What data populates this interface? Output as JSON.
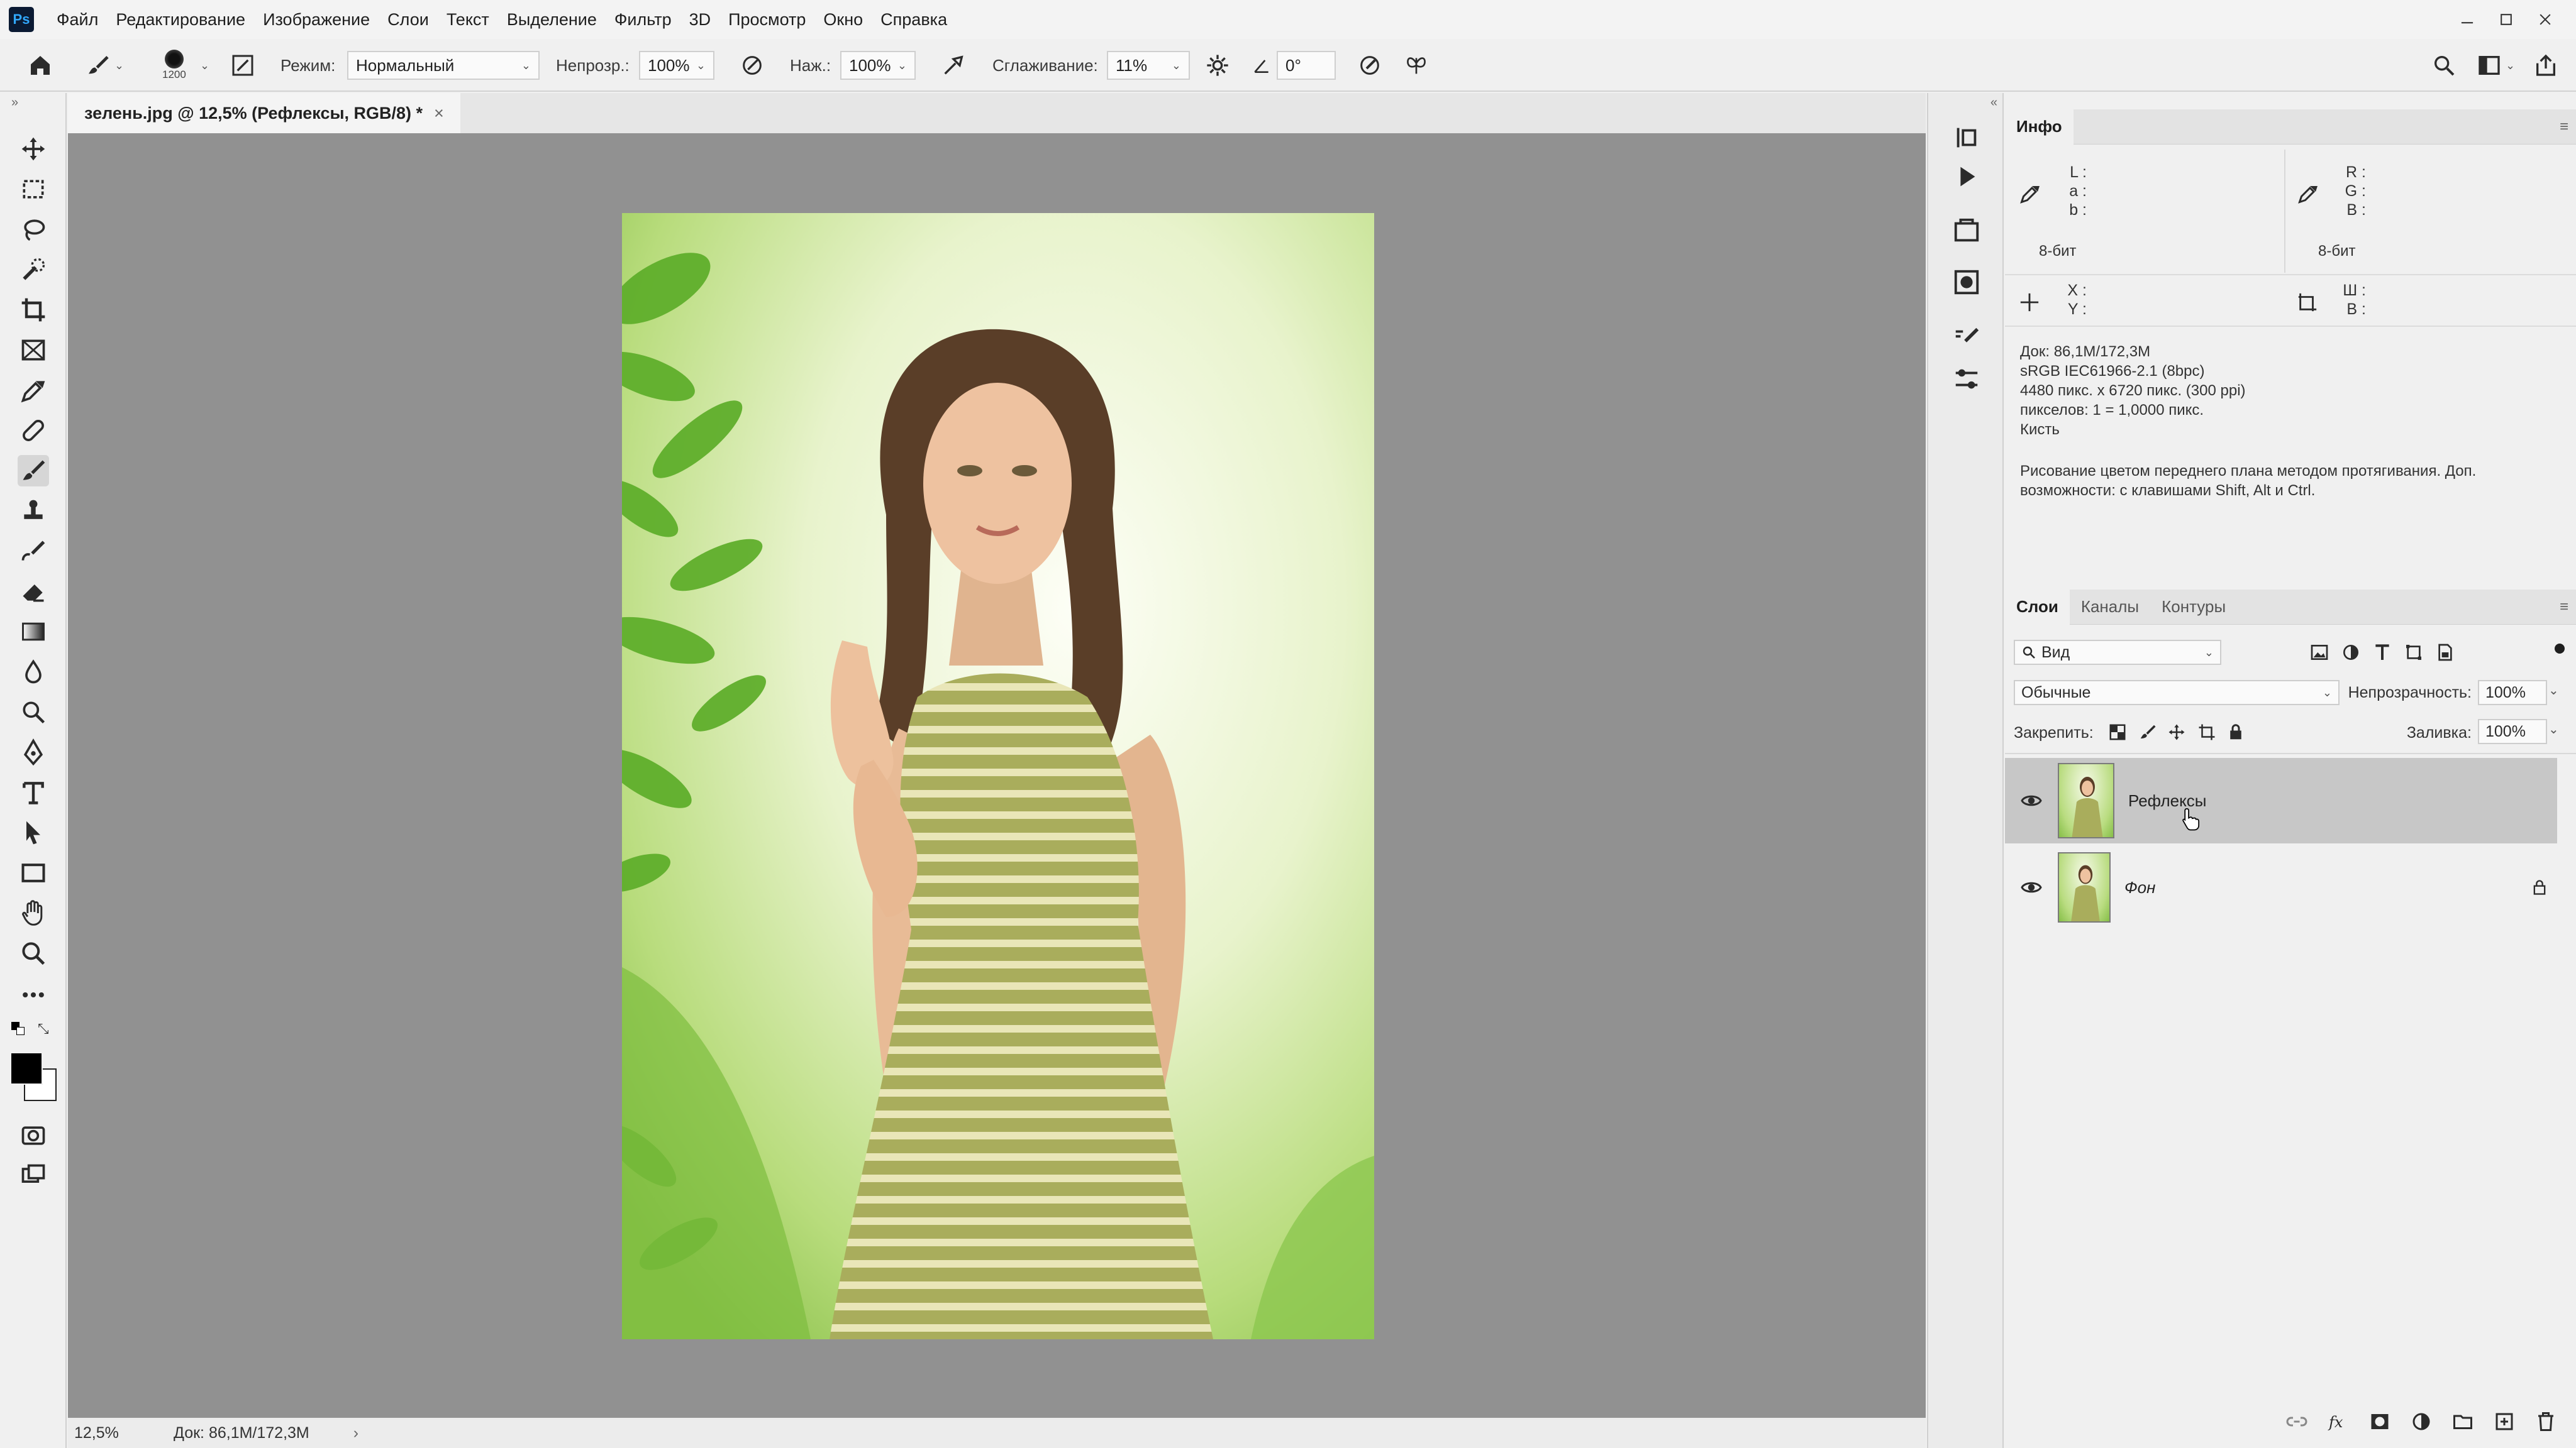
{
  "app": {
    "logo": "Ps"
  },
  "menu": [
    "Файл",
    "Редактирование",
    "Изображение",
    "Слои",
    "Текст",
    "Выделение",
    "Фильтр",
    "3D",
    "Просмотр",
    "Окно",
    "Справка"
  ],
  "options": {
    "brush_size": "1200",
    "mode_label": "Режим:",
    "mode_value": "Нормальный",
    "opacity_label": "Непрозр.:",
    "opacity_value": "100%",
    "flow_label": "Наж.:",
    "flow_value": "100%",
    "smoothing_label": "Сглаживание:",
    "smoothing_value": "11%",
    "angle_value": "0°"
  },
  "document": {
    "tab_title": "зелень.jpg @ 12,5% (Рефлексы, RGB/8) *",
    "close": "×"
  },
  "status": {
    "zoom": "12,5%",
    "doc": "Док: 86,1M/172,3M",
    "arrow": "›"
  },
  "info_panel": {
    "tab": "Инфо",
    "lab_labels": [
      "L :",
      "a :",
      "b :"
    ],
    "rgb_labels": [
      "R :",
      "G :",
      "B :"
    ],
    "bit_left": "8-бит",
    "bit_right": "8-бит",
    "xy_labels": [
      "X :",
      "Y :"
    ],
    "wh_labels": [
      "Ш :",
      "В :"
    ],
    "details": [
      "Док: 86,1M/172,3M",
      "sRGB IEC61966-2.1 (8bpc)",
      "4480 пикс. x 6720 пикс. (300 ppi)",
      "пикселов: 1 = 1,0000 пикс.",
      "Кисть"
    ],
    "hint": "Рисование цветом переднего плана методом протягивания. Доп. возможности: с клавишами Shift, Alt и Ctrl."
  },
  "layers_panel": {
    "tabs": [
      "Слои",
      "Каналы",
      "Контуры"
    ],
    "filter": "Вид",
    "blend": "Обычные",
    "opacity_label": "Непрозрачность:",
    "opacity_value": "100%",
    "lock_label": "Закрепить:",
    "fill_label": "Заливка:",
    "fill_value": "100%",
    "layers": [
      {
        "name": "Рефлексы",
        "selected": true
      },
      {
        "name": "Фон",
        "selected": false
      }
    ]
  },
  "colors": {
    "foreground": "#000000",
    "background": "#ffffff",
    "canvas_bg": "#919191",
    "selection": "#c7c7c7"
  }
}
